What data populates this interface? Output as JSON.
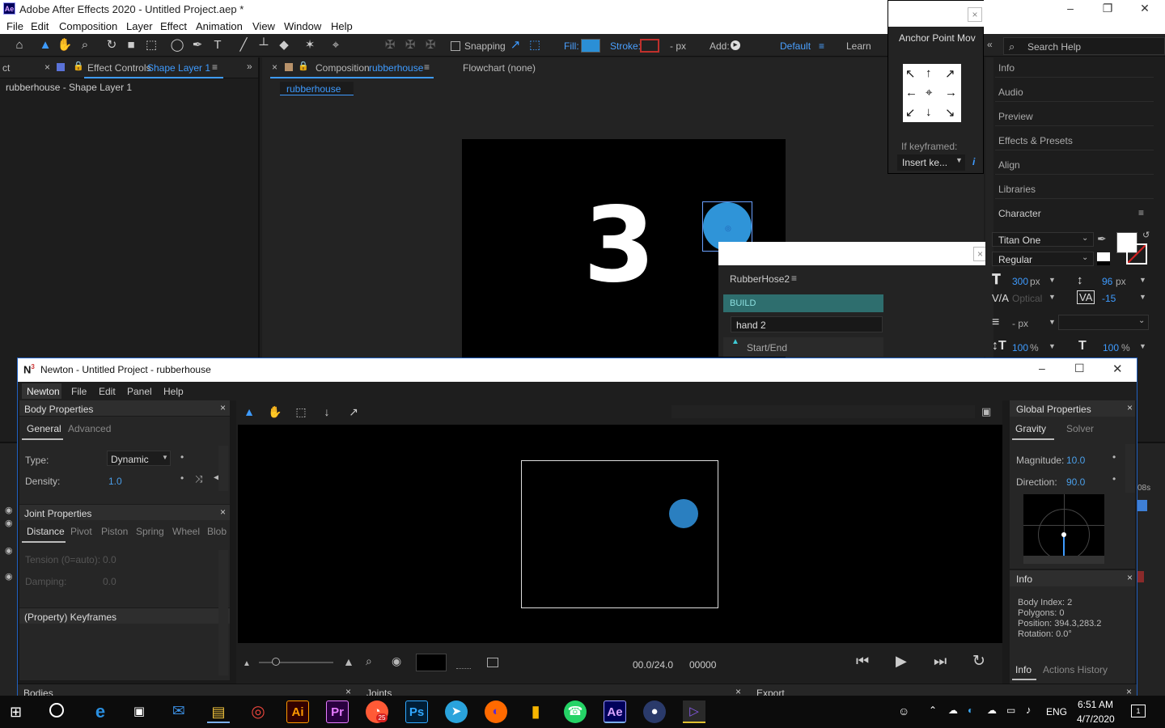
{
  "app": {
    "title": "Adobe After Effects 2020 - Untitled Project.aep *",
    "logo_text": "Ae"
  },
  "menu": [
    "File",
    "Edit",
    "Composition",
    "Layer",
    "Effect",
    "Animation",
    "View",
    "Window",
    "Help"
  ],
  "toolbar": {
    "snapping": "Snapping",
    "fill": "Fill:",
    "stroke": "Stroke:",
    "stroke_px": "- px",
    "add": "Add:",
    "workspace": "Default",
    "learn": "Learn",
    "search_placeholder": "Search Help",
    "fill_color": "#2b8fd6"
  },
  "left_panel": {
    "tab_cut": "ct",
    "tab_label": "Effect Controls",
    "tab_layer": "Shape Layer 1",
    "subtitle": "rubberhouse - Shape Layer 1"
  },
  "comp_panel": {
    "tab_label": "Composition",
    "tab_comp": "rubberhouse",
    "flowchart": "Flowchart (none)",
    "comp_tab": "rubberhouse",
    "digit": "3",
    "circle_color": "#2f94d8"
  },
  "anchor_panel": {
    "title": "Anchor Point Mov",
    "if_keyframed": "If keyframed:",
    "insert": "Insert ke..."
  },
  "rubberhose": {
    "title": "RubberHose2",
    "build": "BUILD",
    "hand": "hand 2",
    "start_end": "Start/End"
  },
  "right_panel": {
    "items": [
      "Info",
      "Audio",
      "Preview",
      "Effects & Presets",
      "Align",
      "Libraries"
    ],
    "character": "Character",
    "font": "Titan One",
    "style": "Regular",
    "font_size": "300",
    "font_unit": "px",
    "leading": "96",
    "leading_unit": "px",
    "kerning": "Optical",
    "tracking": "-15",
    "stroke_px": "- px",
    "vscale": "100",
    "vscale_unit": "%",
    "hscale": "100",
    "hscale_unit": "%"
  },
  "timeline": {
    "partial": "08s"
  },
  "newton": {
    "logo": "N",
    "logo_sup": "3",
    "title": "Newton - Untitled Project - rubberhouse",
    "menu": [
      "Newton",
      "File",
      "Edit",
      "Panel",
      "Help"
    ],
    "body_props": {
      "title": "Body Properties",
      "tabs": [
        "General",
        "Advanced"
      ],
      "type_label": "Type:",
      "type_value": "Dynamic",
      "density_label": "Density:",
      "density_value": "1.0"
    },
    "joint_props": {
      "title": "Joint Properties",
      "tabs": [
        "Distance",
        "Pivot",
        "Piston",
        "Spring",
        "Wheel",
        "Blob"
      ],
      "tension_label": "Tension (0=auto):",
      "tension_value": "0.0",
      "damping_label": "Damping:",
      "damping_value": "0.0"
    },
    "keyframes": {
      "title": "(Property) Keyframes"
    },
    "viewport": {
      "time": "00.0/24.0",
      "frame": "00000"
    },
    "global_props": {
      "title": "Global Properties",
      "tabs": [
        "Gravity",
        "Solver"
      ],
      "magnitude_label": "Magnitude:",
      "magnitude_value": "10.0",
      "direction_label": "Direction:",
      "direction_value": "90.0"
    },
    "info": {
      "title": "Info",
      "body_index": "Body Index: 2",
      "polygons": "Polygons: 0",
      "position": "Position: 394.3,283.2",
      "rotation": "Rotation: 0.0°",
      "tabs": [
        "Info",
        "Actions History"
      ]
    },
    "bottom_tabs": [
      "Bodies",
      "Joints",
      "Export"
    ]
  },
  "taskbar": {
    "lang": "ENG",
    "time": "6:51 AM",
    "date": "4/7/2020",
    "notif": "1",
    "ai": "Ai",
    "pr": "Pr",
    "ps": "Ps",
    "ae": "Ae",
    "badge": "25"
  }
}
